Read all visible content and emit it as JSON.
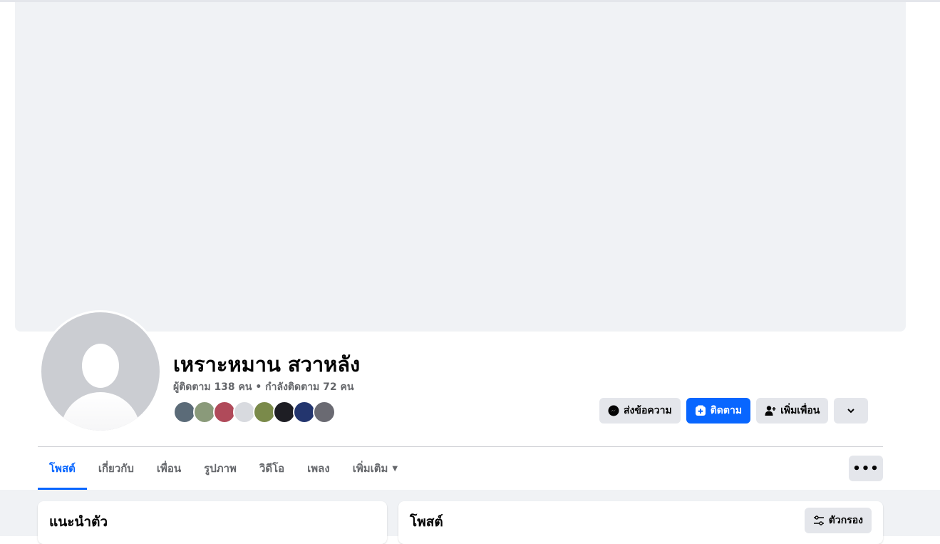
{
  "profile": {
    "name": "เหราะหมาน สวาหลัง",
    "stats": "ผู้ติดตาม 138 คน • กำลังติดตาม 72 คน",
    "friend_avatars": [
      "#5b6b78",
      "#8a9a7a",
      "#b04a5a",
      "#d8dadf",
      "#7a8a4a",
      "#1e1e24",
      "#23356e",
      "#6a6a72"
    ]
  },
  "actions": {
    "message_label": "ส่งข้อความ",
    "follow_label": "ติดตาม",
    "add_friend_label": "เพิ่มเพื่อน"
  },
  "tabs": [
    {
      "label": "โพสต์"
    },
    {
      "label": "เกี่ยวกับ"
    },
    {
      "label": "เพื่อน"
    },
    {
      "label": "รูปภาพ"
    },
    {
      "label": "วิดีโอ"
    },
    {
      "label": "เพลง"
    },
    {
      "label": "เพิ่มเติม"
    }
  ],
  "intro": {
    "title": "แนะนำตัว"
  },
  "posts": {
    "title": "โพสต์",
    "filter_label": "ตัวกรอง"
  },
  "colors": {
    "accent": "#0866ff",
    "button_gray": "#e4e6eb",
    "background": "#f0f2f5"
  }
}
